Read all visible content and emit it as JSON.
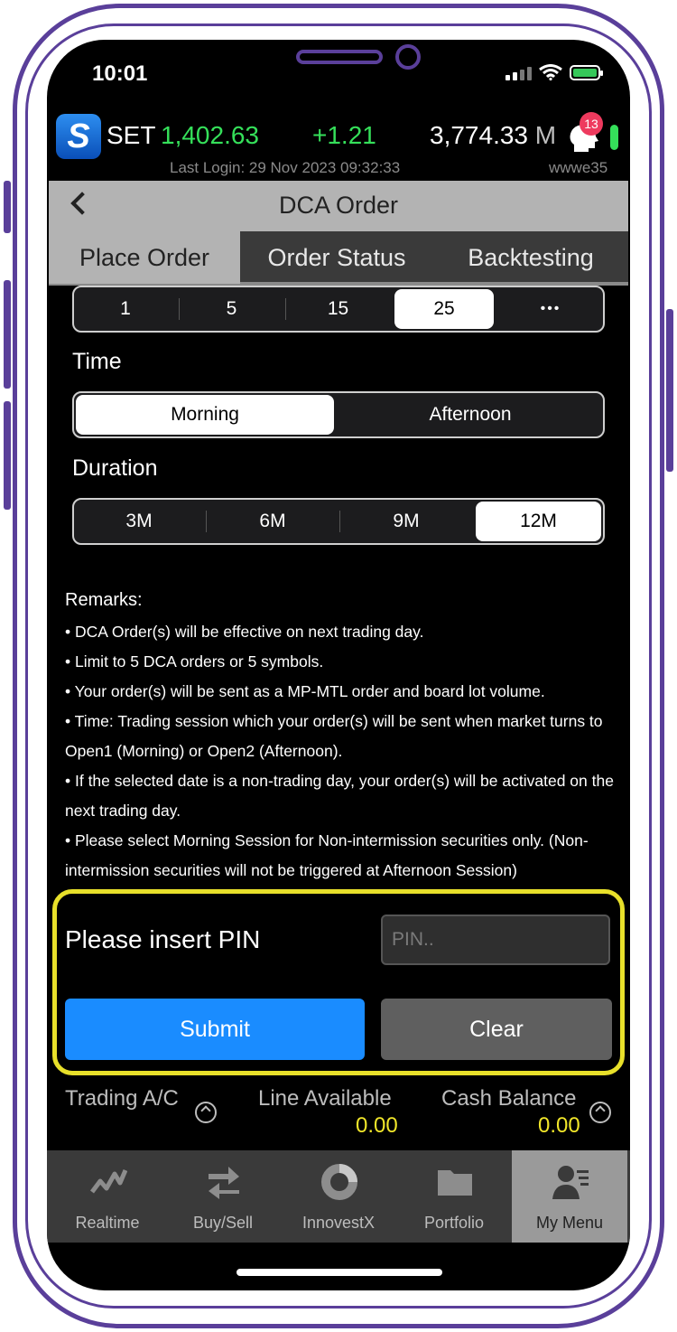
{
  "status_bar": {
    "time": "10:01"
  },
  "ticker": {
    "name": "SET",
    "price": "1,402.63",
    "change": "+1.21",
    "volume": "3,774.33",
    "volume_unit": "M",
    "notification_count": "13",
    "last_login": "Last Login: 29 Nov 2023 09:32:33",
    "user_id": "wwwe35"
  },
  "header": {
    "title": "DCA Order"
  },
  "tabs": [
    {
      "label": "Place Order",
      "active": true
    },
    {
      "label": "Order Status",
      "active": false
    },
    {
      "label": "Backtesting",
      "active": false
    }
  ],
  "day_selector": {
    "options": [
      "1",
      "5",
      "15",
      "25",
      "•••"
    ],
    "selected": "25"
  },
  "time": {
    "label": "Time",
    "options": [
      "Morning",
      "Afternoon"
    ],
    "selected": "Morning"
  },
  "duration": {
    "label": "Duration",
    "options": [
      "3M",
      "6M",
      "9M",
      "12M"
    ],
    "selected": "12M"
  },
  "remarks": {
    "title": "Remarks:",
    "lines": [
      "• DCA Order(s) will be effective on next trading day.",
      "• Limit to 5 DCA orders or 5 symbols.",
      "• Your order(s) will be sent as a MP-MTL order and board lot volume.",
      "• Time: Trading session which your order(s) will be sent when market turns to Open1 (Morning) or Open2 (Afternoon).",
      "• If the selected date is a non-trading day, your order(s) will be activated on the next trading day.",
      "• Please select Morning Session for Non-intermission securities only. (Non-intermission securities will not be triggered at Afternoon Session)"
    ]
  },
  "pin": {
    "label": "Please insert PIN",
    "placeholder": "PIN..",
    "value": "",
    "submit_label": "Submit",
    "clear_label": "Clear"
  },
  "account": {
    "trading_ac_label": "Trading A/C",
    "line_available_label": "Line Available",
    "line_available_value": "0.00",
    "cash_balance_label": "Cash Balance",
    "cash_balance_value": "0.00"
  },
  "bottom_nav": [
    {
      "label": "Realtime",
      "icon": "chart-line-icon",
      "active": false
    },
    {
      "label": "Buy/Sell",
      "icon": "swap-arrows-icon",
      "active": false
    },
    {
      "label": "InnovestX",
      "icon": "donut-chart-icon",
      "active": false
    },
    {
      "label": "Portfolio",
      "icon": "folder-icon",
      "active": false
    },
    {
      "label": "My Menu",
      "icon": "user-menu-icon",
      "active": true
    }
  ],
  "colors": {
    "accent_green": "#35e05a",
    "highlight_yellow": "#e8e02a",
    "submit_blue": "#1a8cff",
    "value_yellow": "#f1e62a",
    "frame_purple": "#5a3f9a"
  }
}
